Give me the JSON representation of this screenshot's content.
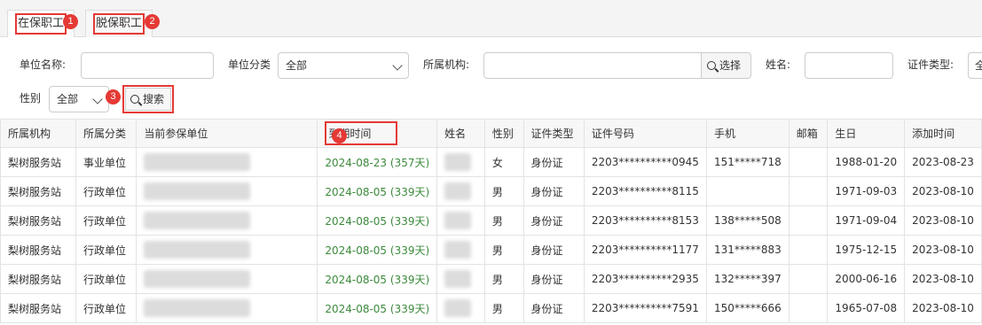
{
  "tabs": [
    {
      "label": "在保职工",
      "badge": "1"
    },
    {
      "label": "脱保职工",
      "badge": "2"
    }
  ],
  "filters": {
    "unit_name_label": "单位名称:",
    "unit_category_label": "单位分类",
    "unit_category_value": "全部",
    "org_label": "所属机构:",
    "select_button": "选择",
    "name_label": "姓名:",
    "id_type_label": "证件类型:",
    "id_type_value": "全",
    "gender_label": "性别",
    "gender_value": "全部",
    "search_badge": "3",
    "search_button": "搜索"
  },
  "table": {
    "expiry_badge": "4",
    "columns": [
      "所属机构",
      "所属分类",
      "当前参保单位",
      "到期时间",
      "姓名",
      "性别",
      "证件类型",
      "证件号码",
      "手机",
      "邮箱",
      "生日",
      "添加时间"
    ],
    "rows": [
      {
        "org": "梨树服务站",
        "category": "事业单位",
        "expiry": "2024-08-23 (357天)",
        "gender": "女",
        "id_type": "身份证",
        "id_no": "2203**********0945",
        "phone": "151*****718",
        "email": "",
        "birthday": "1988-01-20",
        "added": "2023-08-23"
      },
      {
        "org": "梨树服务站",
        "category": "行政单位",
        "expiry": "2024-08-05 (339天)",
        "gender": "男",
        "id_type": "身份证",
        "id_no": "2203**********8115",
        "phone": "",
        "email": "",
        "birthday": "1971-09-03",
        "added": "2023-08-10"
      },
      {
        "org": "梨树服务站",
        "category": "行政单位",
        "expiry": "2024-08-05 (339天)",
        "gender": "男",
        "id_type": "身份证",
        "id_no": "2203**********8153",
        "phone": "138*****508",
        "email": "",
        "birthday": "1971-09-04",
        "added": "2023-08-10"
      },
      {
        "org": "梨树服务站",
        "category": "行政单位",
        "expiry": "2024-08-05 (339天)",
        "gender": "男",
        "id_type": "身份证",
        "id_no": "2203**********1177",
        "phone": "131*****883",
        "email": "",
        "birthday": "1975-12-15",
        "added": "2023-08-10"
      },
      {
        "org": "梨树服务站",
        "category": "行政单位",
        "expiry": "2024-08-05 (339天)",
        "gender": "男",
        "id_type": "身份证",
        "id_no": "2203**********2935",
        "phone": "132*****397",
        "email": "",
        "birthday": "2000-06-16",
        "added": "2023-08-10"
      },
      {
        "org": "梨树服务站",
        "category": "行政单位",
        "expiry": "2024-08-05 (339天)",
        "gender": "男",
        "id_type": "身份证",
        "id_no": "2203**********7591",
        "phone": "150*****666",
        "email": "",
        "birthday": "1965-07-08",
        "added": "2023-08-10"
      }
    ]
  }
}
